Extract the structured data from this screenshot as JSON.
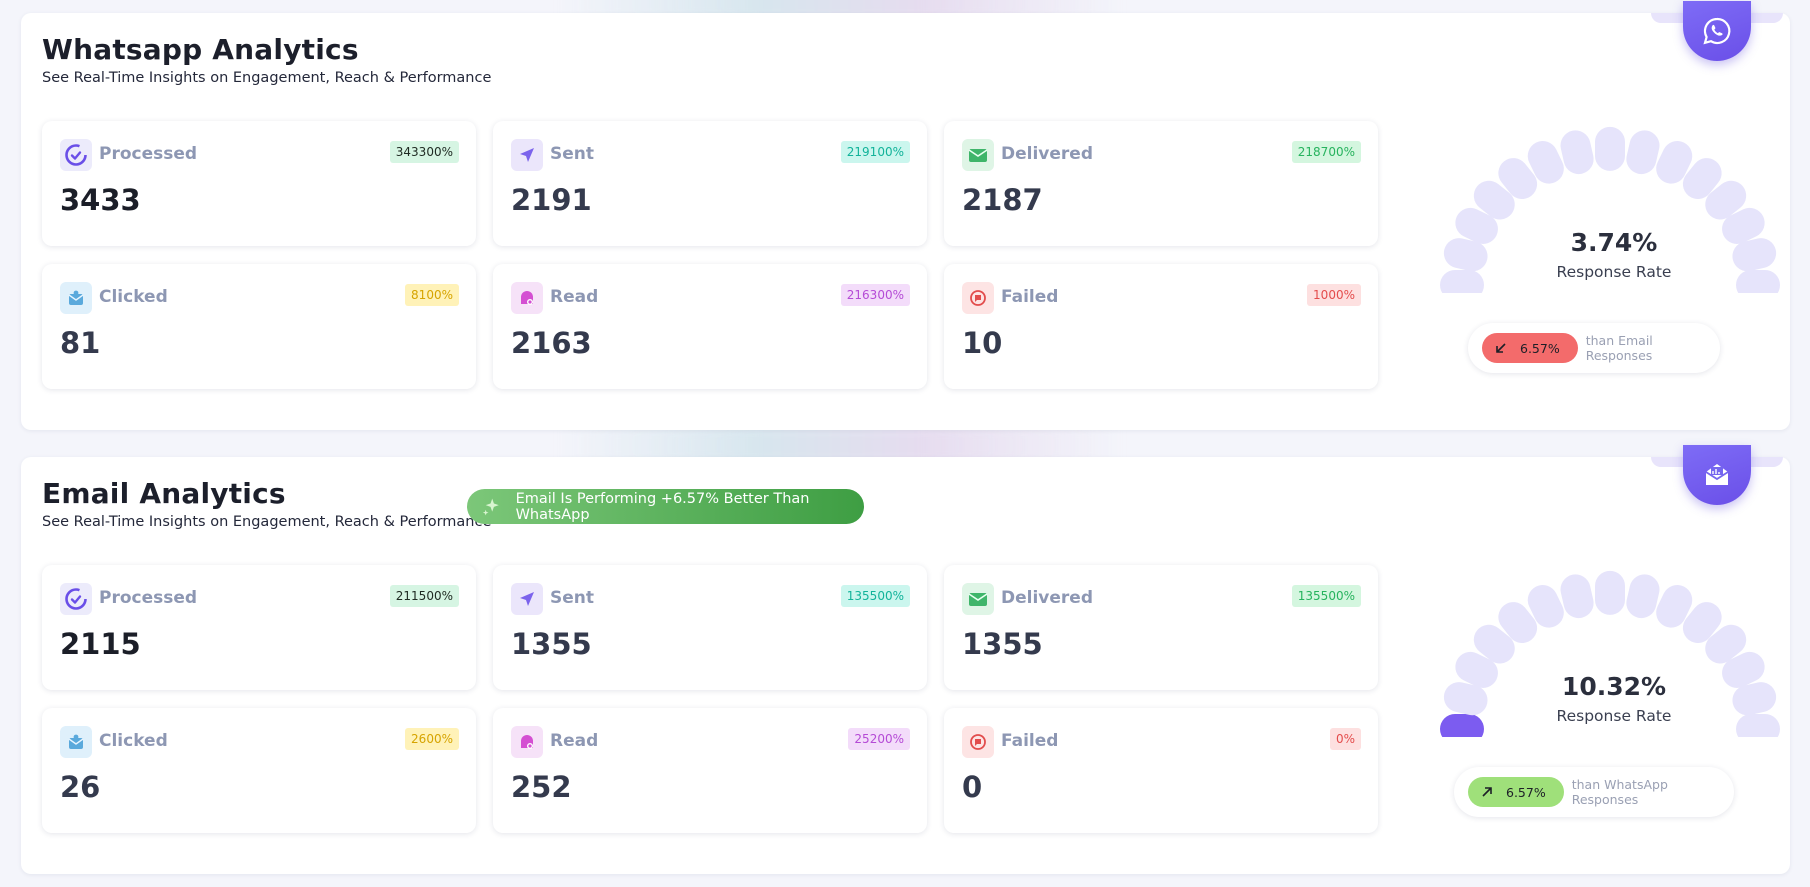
{
  "whatsapp": {
    "title": "Whatsapp Analytics",
    "subtitle": "See Real-Time Insights on Engagement, Reach & Performance",
    "corner_icon": "whatsapp-icon",
    "cards": [
      {
        "label": "Processed",
        "badge": "343300%",
        "value": "3433",
        "icon": "processed-icon"
      },
      {
        "label": "Sent",
        "badge": "219100%",
        "value": "2191",
        "icon": "paper-plane-icon"
      },
      {
        "label": "Delivered",
        "badge": "218700%",
        "value": "2187",
        "icon": "mail-check-icon"
      },
      {
        "label": "Clicked",
        "badge": "8100%",
        "value": "81",
        "icon": "mail-click-icon"
      },
      {
        "label": "Read",
        "badge": "216300%",
        "value": "2163",
        "icon": "read-icon"
      },
      {
        "label": "Failed",
        "badge": "1000%",
        "value": "10",
        "icon": "failed-icon"
      }
    ],
    "gauge": {
      "percent": "3.74%",
      "label": "Response Rate",
      "filled_segments": 0,
      "total_segments": 15
    },
    "comparison": {
      "value": "6.57%",
      "direction": "down",
      "text": "than Email Responses",
      "color": "#f36b6b",
      "icon": "arrow-down-left-icon"
    }
  },
  "email": {
    "title": "Email Analytics",
    "subtitle": "See Real-Time Insights on Engagement, Reach & Performance",
    "performance_badge": "Email Is Performing +6.57% Better Than WhatsApp",
    "performance_icon": "sparkle-icon",
    "corner_icon": "envelope-icon",
    "cards": [
      {
        "label": "Processed",
        "badge": "211500%",
        "value": "2115",
        "icon": "processed-icon"
      },
      {
        "label": "Sent",
        "badge": "135500%",
        "value": "1355",
        "icon": "paper-plane-icon"
      },
      {
        "label": "Delivered",
        "badge": "135500%",
        "value": "1355",
        "icon": "mail-check-icon"
      },
      {
        "label": "Clicked",
        "badge": "2600%",
        "value": "26",
        "icon": "mail-click-icon"
      },
      {
        "label": "Read",
        "badge": "25200%",
        "value": "252",
        "icon": "read-icon"
      },
      {
        "label": "Failed",
        "badge": "0%",
        "value": "0",
        "icon": "failed-icon"
      }
    ],
    "gauge": {
      "percent": "10.32%",
      "label": "Response Rate",
      "filled_segments": 1,
      "total_segments": 15
    },
    "comparison": {
      "value": "6.57%",
      "direction": "up",
      "text": "than WhatsApp Responses",
      "color": "#9fe07a",
      "icon": "arrow-up-right-icon"
    }
  },
  "colors": {
    "processed_badge": "#d6f5e3",
    "sent_badge": "#cbf6ee",
    "delivered_badge": "#d4f6df",
    "clicked_badge": "#fff2b8",
    "read_badge": "#f3dcfa",
    "failed_badge": "#fde0e0",
    "gauge_empty": "#e6e4fb",
    "gauge_filled": "#7c5cf0"
  }
}
